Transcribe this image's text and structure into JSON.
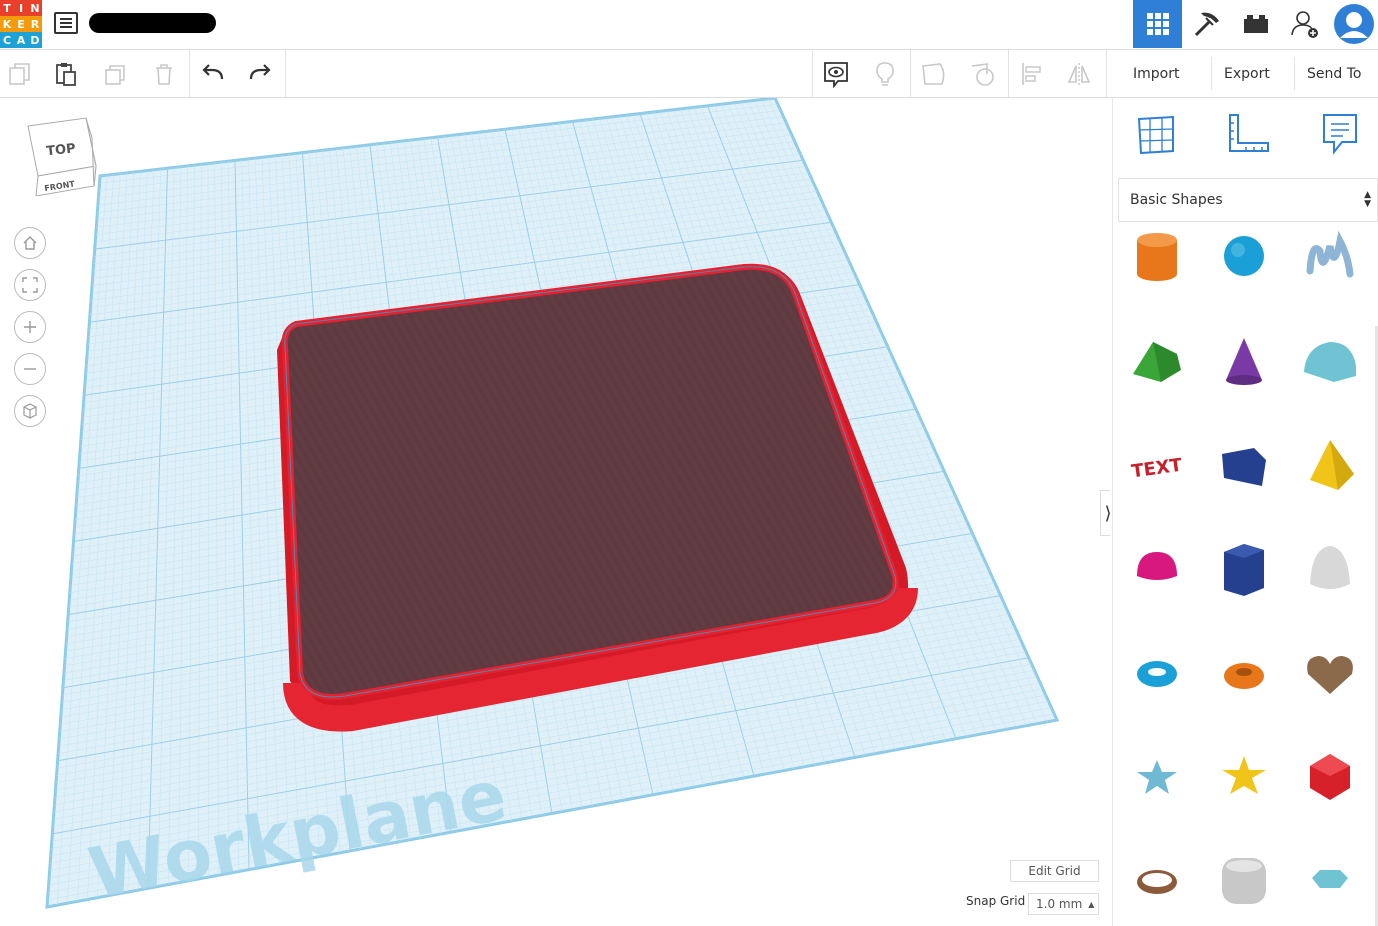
{
  "app": {
    "logo_letters": [
      "T",
      "I",
      "N",
      "K",
      "E",
      "R",
      "C",
      "A",
      "D"
    ],
    "logo_colors": [
      "#e8402a",
      "#e8402a",
      "#e8402a",
      "#f59a0b",
      "#f59a0b",
      "#f59a0b",
      "#1ea1d6",
      "#1ea1d6",
      "#1ea1d6"
    ]
  },
  "topbar": {
    "icons": [
      "3d-design-grid-icon",
      "pickaxe-icon",
      "bricks-icon",
      "add-user-icon",
      "user-avatar"
    ]
  },
  "toolbar": {
    "edit_icons": [
      "copy-icon",
      "paste-icon",
      "duplicate-icon",
      "delete-icon",
      "undo-icon",
      "redo-icon"
    ],
    "view_icons": [
      "notes-visibility-icon",
      "light-bulb-icon",
      "group-icon",
      "ungroup-icon",
      "align-icon",
      "mirror-icon"
    ],
    "import_label": "Import",
    "export_label": "Export",
    "send_to_label": "Send To"
  },
  "viewcube": {
    "top_label": "TOP",
    "front_label": "FRONT"
  },
  "workplane": {
    "label": "Workplane",
    "shape_color": "#e8202f",
    "shape_selected_overlay": "#5e3a40"
  },
  "viewport": {
    "edit_grid_label": "Edit Grid",
    "snap_grid_label": "Snap Grid",
    "snap_grid_value": "1.0 mm"
  },
  "panel": {
    "tabs": [
      "workplane-grid-icon",
      "ruler-icon",
      "notes-icon"
    ],
    "category": "Basic Shapes",
    "shapes": [
      {
        "name": "cylinder",
        "color": "#e8761a"
      },
      {
        "name": "sphere",
        "color": "#1a9fd6"
      },
      {
        "name": "scribble",
        "color": "#8fb5d6"
      },
      {
        "name": "roof",
        "color": "#3aa638"
      },
      {
        "name": "cone",
        "color": "#7a3aa6"
      },
      {
        "name": "round-roof",
        "color": "#6fc3d3"
      },
      {
        "name": "text",
        "color": "#c8202a"
      },
      {
        "name": "box",
        "color": "#24408f"
      },
      {
        "name": "pyramid",
        "color": "#f0c419"
      },
      {
        "name": "half-sphere",
        "color": "#d6187f"
      },
      {
        "name": "polygon",
        "color": "#24408f"
      },
      {
        "name": "paraboloid",
        "color": "#d8d8d8"
      },
      {
        "name": "torus",
        "color": "#1a9fd6"
      },
      {
        "name": "tube",
        "color": "#e8761a"
      },
      {
        "name": "heart",
        "color": "#8a6a4a"
      },
      {
        "name": "star",
        "color": "#6fb9d3"
      },
      {
        "name": "star-gold",
        "color": "#f0c419"
      },
      {
        "name": "icosahedron",
        "color": "#d6202a"
      },
      {
        "name": "ring",
        "color": "#8a5a3a"
      },
      {
        "name": "rounded-box",
        "color": "#c8c8c8"
      },
      {
        "name": "diamond",
        "color": "#6fc3d3"
      }
    ]
  }
}
